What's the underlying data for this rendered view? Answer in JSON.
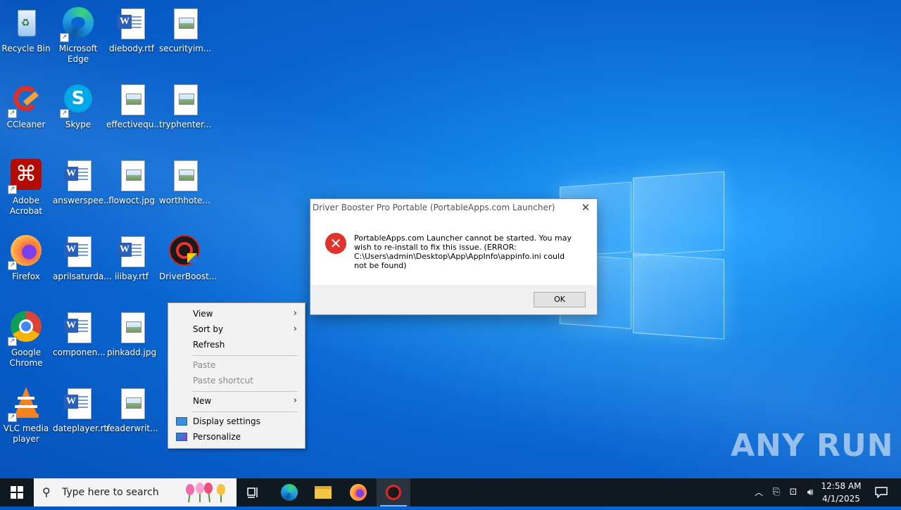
{
  "desktop": {
    "icons": [
      {
        "label": "Recycle Bin"
      },
      {
        "label": "Microsoft Edge"
      },
      {
        "label": "diebody.rtf"
      },
      {
        "label": "securityim..."
      },
      {
        "label": "CCleaner"
      },
      {
        "label": "Skype"
      },
      {
        "label": "effectivequ..."
      },
      {
        "label": "tryphenter..."
      },
      {
        "label": "Adobe Acrobat"
      },
      {
        "label": "answerspee..."
      },
      {
        "label": "flowoct.jpg"
      },
      {
        "label": "worthhote..."
      },
      {
        "label": "Firefox"
      },
      {
        "label": "aprilsaturda..."
      },
      {
        "label": "iiibay.rtf"
      },
      {
        "label": "DriverBoost..."
      },
      {
        "label": "Google Chrome"
      },
      {
        "label": "componen..."
      },
      {
        "label": "pinkadd.jpg"
      },
      {
        "label": "VLC media player"
      },
      {
        "label": "dateplayer.rtf"
      },
      {
        "label": "readerwrit..."
      }
    ]
  },
  "dialog": {
    "title": "Driver Booster Pro Portable (PortableApps.com Launcher)",
    "message": "PortableApps.com Launcher cannot be started. You may wish to re-install to fix this issue. (ERROR: C:\\Users\\admin\\Desktop\\App\\AppInfo\\appinfo.ini could not be found)",
    "ok_label": "OK",
    "close_glyph": "✕",
    "error_glyph": "✕"
  },
  "context_menu": {
    "view": "View",
    "sort_by": "Sort by",
    "refresh": "Refresh",
    "paste": "Paste",
    "paste_shortcut": "Paste shortcut",
    "new": "New",
    "display_settings": "Display settings",
    "personalize": "Personalize",
    "submenu_glyph": "›"
  },
  "taskbar": {
    "search_placeholder": "Type here to search",
    "time": "12:58 AM",
    "date": "4/1/2025"
  },
  "watermark": "ANY RUN",
  "colors": {
    "accent": "#0a66d2",
    "error": "#e0332b",
    "taskbar": "#101820"
  }
}
